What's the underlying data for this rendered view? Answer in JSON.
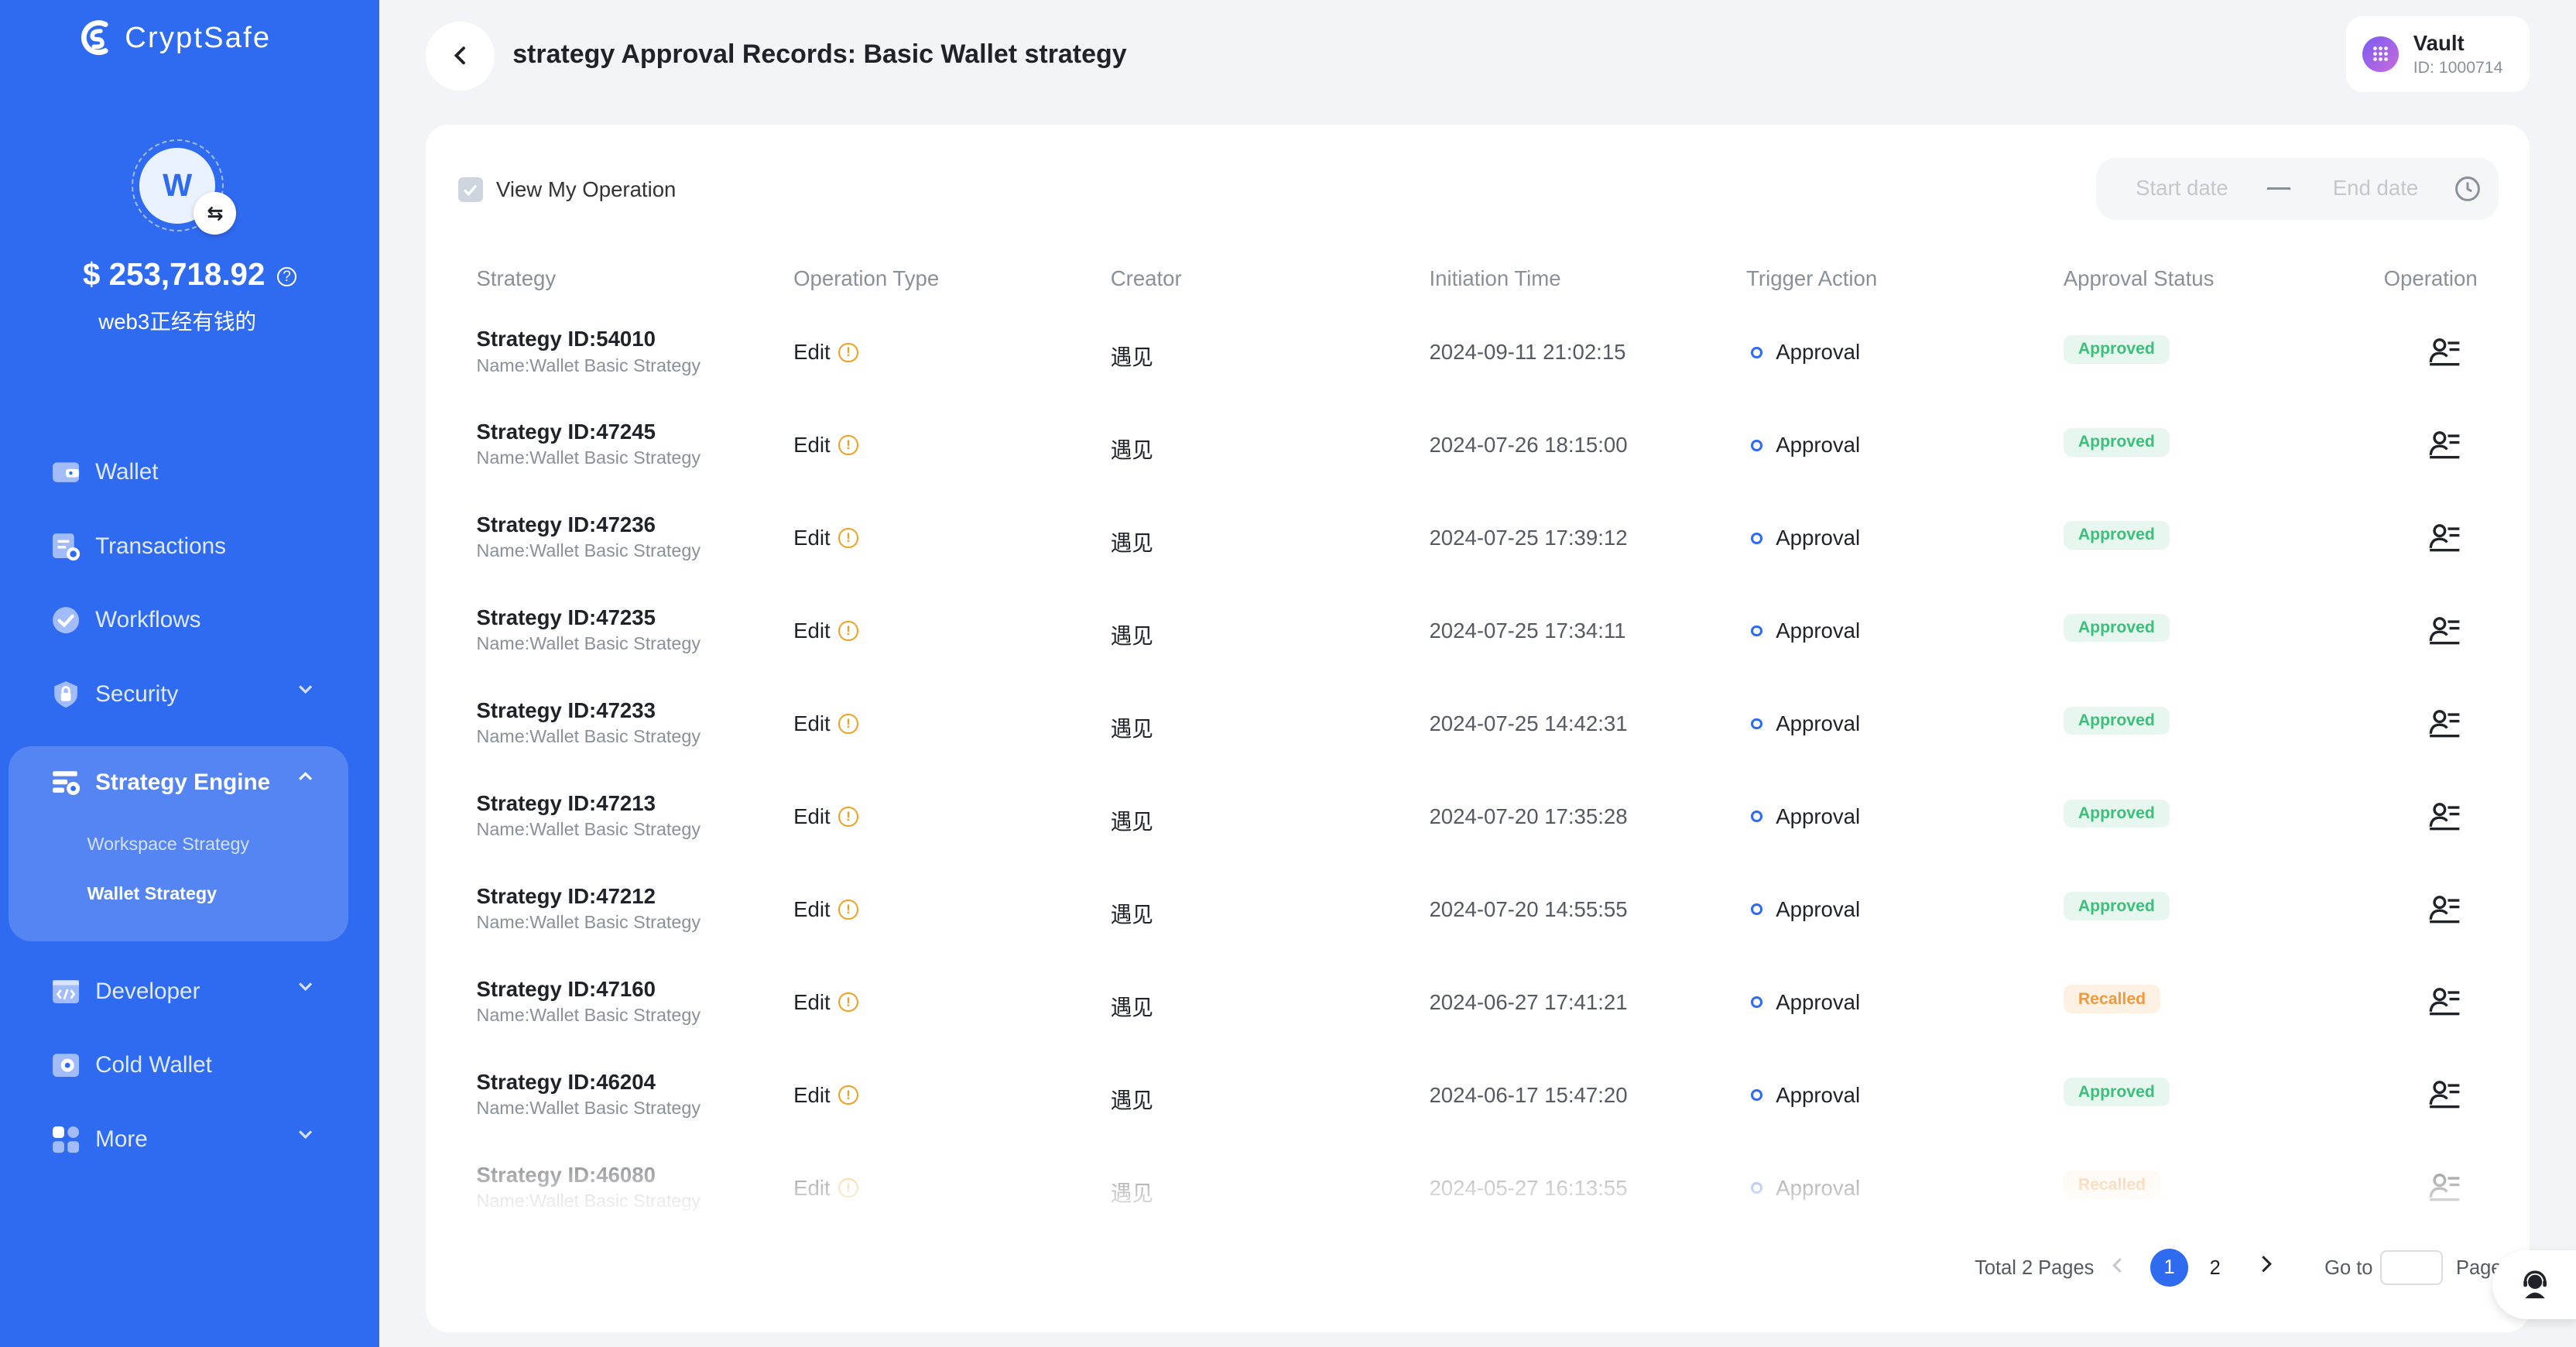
{
  "app": {
    "name": "CryptSafe"
  },
  "wallet": {
    "avatar_letter": "W",
    "balance": "$ 253,718.92",
    "name": "web3正经有钱的"
  },
  "sidebar": {
    "items": [
      {
        "label": "Wallet",
        "icon": "wallet-icon"
      },
      {
        "label": "Transactions",
        "icon": "transactions-icon"
      },
      {
        "label": "Workflows",
        "icon": "workflows-icon"
      },
      {
        "label": "Security",
        "icon": "shield-icon"
      },
      {
        "label": "Strategy Engine",
        "icon": "strategy-engine-icon"
      },
      {
        "label": "Developer",
        "icon": "developer-icon"
      },
      {
        "label": "Cold Wallet",
        "icon": "cold-wallet-icon"
      },
      {
        "label": "More",
        "icon": "grid-icon"
      }
    ],
    "strategy_sub": [
      "Workspace Strategy",
      "Wallet Strategy"
    ]
  },
  "header": {
    "title": "strategy Approval Records: Basic Wallet strategy"
  },
  "vault": {
    "name": "Vault",
    "id": "ID: 1000714"
  },
  "filters": {
    "view_my_operation": "View My Operation",
    "start_date": "Start date",
    "end_date": "End date"
  },
  "table": {
    "columns": [
      "Strategy",
      "Operation Type",
      "Creator",
      "Initiation Time",
      "Trigger Action",
      "Approval Status",
      "Operation"
    ],
    "rows": [
      {
        "strategy_id": "Strategy ID:54010",
        "name": "Name:Wallet Basic Strategy",
        "op_type": "Edit",
        "creator": "遇见",
        "time": "2024-09-11 21:02:15",
        "trigger": "Approval",
        "status": "Approved"
      },
      {
        "strategy_id": "Strategy ID:47245",
        "name": "Name:Wallet Basic Strategy",
        "op_type": "Edit",
        "creator": "遇见",
        "time": "2024-07-26 18:15:00",
        "trigger": "Approval",
        "status": "Approved"
      },
      {
        "strategy_id": "Strategy ID:47236",
        "name": "Name:Wallet Basic Strategy",
        "op_type": "Edit",
        "creator": "遇见",
        "time": "2024-07-25 17:39:12",
        "trigger": "Approval",
        "status": "Approved"
      },
      {
        "strategy_id": "Strategy ID:47235",
        "name": "Name:Wallet Basic Strategy",
        "op_type": "Edit",
        "creator": "遇见",
        "time": "2024-07-25 17:34:11",
        "trigger": "Approval",
        "status": "Approved"
      },
      {
        "strategy_id": "Strategy ID:47233",
        "name": "Name:Wallet Basic Strategy",
        "op_type": "Edit",
        "creator": "遇见",
        "time": "2024-07-25 14:42:31",
        "trigger": "Approval",
        "status": "Approved"
      },
      {
        "strategy_id": "Strategy ID:47213",
        "name": "Name:Wallet Basic Strategy",
        "op_type": "Edit",
        "creator": "遇见",
        "time": "2024-07-20 17:35:28",
        "trigger": "Approval",
        "status": "Approved"
      },
      {
        "strategy_id": "Strategy ID:47212",
        "name": "Name:Wallet Basic Strategy",
        "op_type": "Edit",
        "creator": "遇见",
        "time": "2024-07-20 14:55:55",
        "trigger": "Approval",
        "status": "Approved"
      },
      {
        "strategy_id": "Strategy ID:47160",
        "name": "Name:Wallet Basic Strategy",
        "op_type": "Edit",
        "creator": "遇见",
        "time": "2024-06-27 17:41:21",
        "trigger": "Approval",
        "status": "Recalled"
      },
      {
        "strategy_id": "Strategy ID:46204",
        "name": "Name:Wallet Basic Strategy",
        "op_type": "Edit",
        "creator": "遇见",
        "time": "2024-06-17 15:47:20",
        "trigger": "Approval",
        "status": "Approved"
      },
      {
        "strategy_id": "Strategy ID:46080",
        "name": "Name:Wallet Basic Strategy",
        "op_type": "Edit",
        "creator": "遇见",
        "time": "2024-05-27 16:13:55",
        "trigger": "Approval",
        "status": "Recalled"
      }
    ]
  },
  "pagination": {
    "total": "Total 2 Pages",
    "current": "1",
    "next_page": "2",
    "goto": "Go to",
    "page_word": "Page"
  },
  "colors": {
    "brand": "#2f6bf0",
    "approved": "#3cbf7a",
    "recalled": "#f09a3e"
  }
}
